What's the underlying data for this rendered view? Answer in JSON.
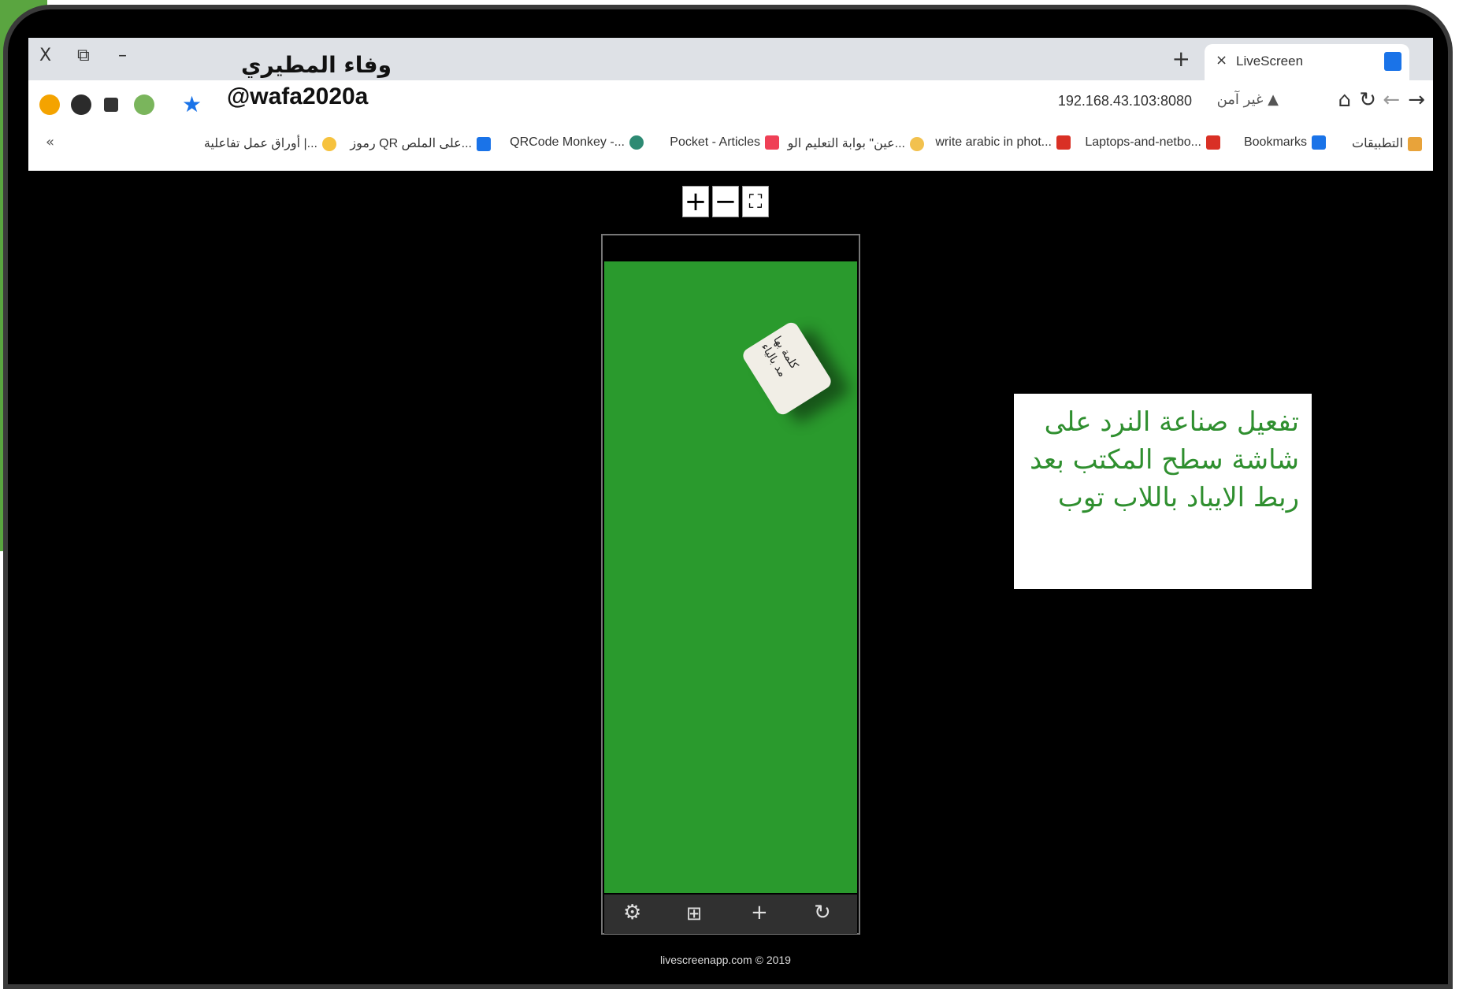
{
  "overlay": {
    "author_name": "وفاء المطيري",
    "handle": "@wafa2020a",
    "caption": "تفعيل صناعة النرد على شاشة سطح المكتب بعد ربط الايباد باللاب توب"
  },
  "browser": {
    "window_controls": {
      "close": "X",
      "restore": "⧉",
      "minimize": "–"
    },
    "tab": {
      "title": "LiveScreen",
      "close": "×"
    },
    "new_tab": "+",
    "address": {
      "url": "192.168.43.103:8080",
      "security_label": "غير آمن"
    },
    "bookmarks": [
      "التطبيقات",
      "Bookmarks",
      "Laptops-and-netbo...",
      "write arabic in phot...",
      "عين\" بوابة التعليم الو...",
      "Pocket - Articles",
      "QRCode Monkey -...",
      "رموز QR على الملص...",
      "أوراق عمل تفاعلية |..."
    ],
    "bookmarks_more": "«"
  },
  "viewer": {
    "zoom_in": "+",
    "zoom_out": "−",
    "fullscreen": "⛶",
    "die_text": "كلمة بها مد بالياء",
    "footer": "livescreenapp.com © 2019"
  },
  "colors": {
    "felt": "#2a9a2d",
    "caption": "#2f8f2f",
    "accent": "#1a73e8"
  }
}
